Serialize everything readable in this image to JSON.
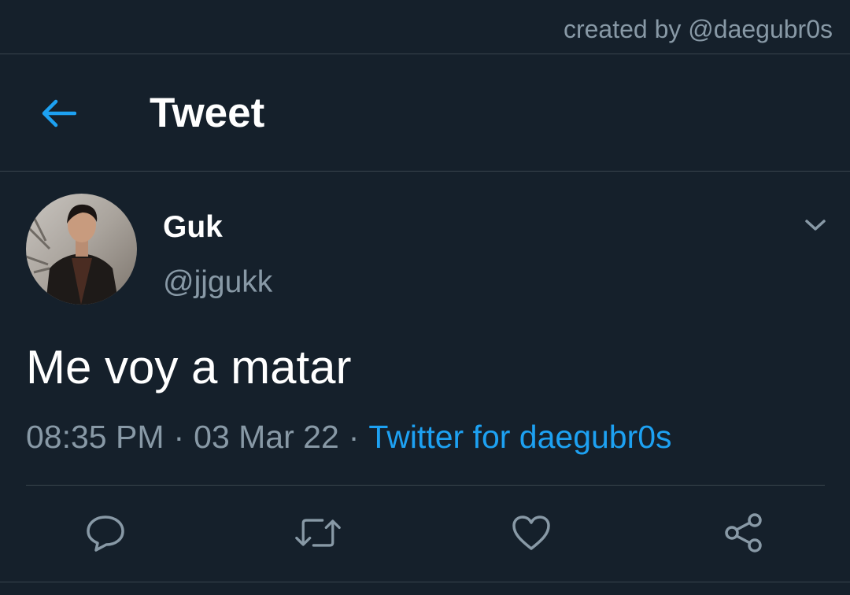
{
  "credit": "created by @daegubr0s",
  "header": {
    "title": "Tweet",
    "back_icon": "arrow-left-icon"
  },
  "tweet": {
    "display_name": "Guk",
    "handle": "@jjgukk",
    "text": "Me voy a matar",
    "time": "08:35 PM",
    "date": "03 Mar 22",
    "separator": "·",
    "source": "Twitter for daegubr0s"
  },
  "actions": [
    {
      "icon": "reply-icon"
    },
    {
      "icon": "retweet-icon"
    },
    {
      "icon": "like-icon"
    },
    {
      "icon": "share-icon"
    }
  ],
  "colors": {
    "background": "#15202b",
    "accent": "#1da1f2",
    "secondary_text": "#8899a6",
    "border": "#38444d"
  }
}
